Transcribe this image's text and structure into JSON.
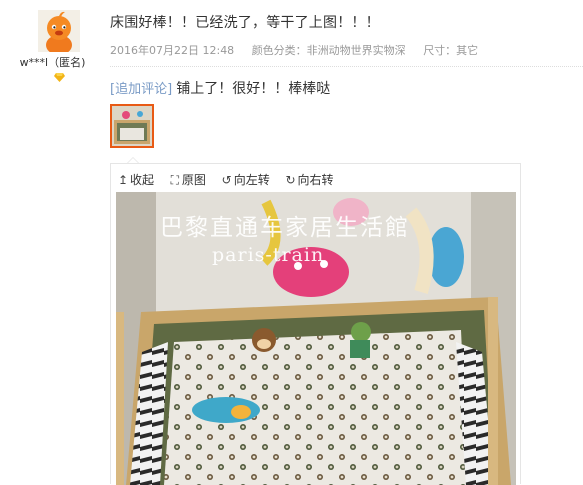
{
  "user": {
    "name": "w***l（匿名)",
    "avatar_icon": "orange-cartoon-avatar-icon",
    "vip_icon": "gold-diamond-icon"
  },
  "review": {
    "content": "床围好棒！！已经洗了，等干了上图！！！",
    "date": "2016年07月22日 12:48",
    "color_category": "颜色分类：非洲动物世界实物深",
    "size": "尺寸：其它"
  },
  "appended": {
    "tag": "[追加评论]",
    "text": "铺上了！很好！！棒棒哒"
  },
  "viewer": {
    "toolbar": [
      {
        "icon": "collapse-arrow-icon",
        "glyph": "↥",
        "label": "收起"
      },
      {
        "icon": "original-size-icon",
        "glyph": "⛶",
        "label": "原图"
      },
      {
        "icon": "rotate-left-icon",
        "glyph": "↺",
        "label": "向左转"
      },
      {
        "icon": "rotate-right-icon",
        "glyph": "↻",
        "label": "向右转"
      }
    ],
    "watermark_title": "巴黎直通车家居生活館",
    "watermark_sub": "paris-train"
  },
  "colors": {
    "accent_border": "#e85a15",
    "tag_color": "#7a9bc6",
    "meta_color": "#999999"
  }
}
